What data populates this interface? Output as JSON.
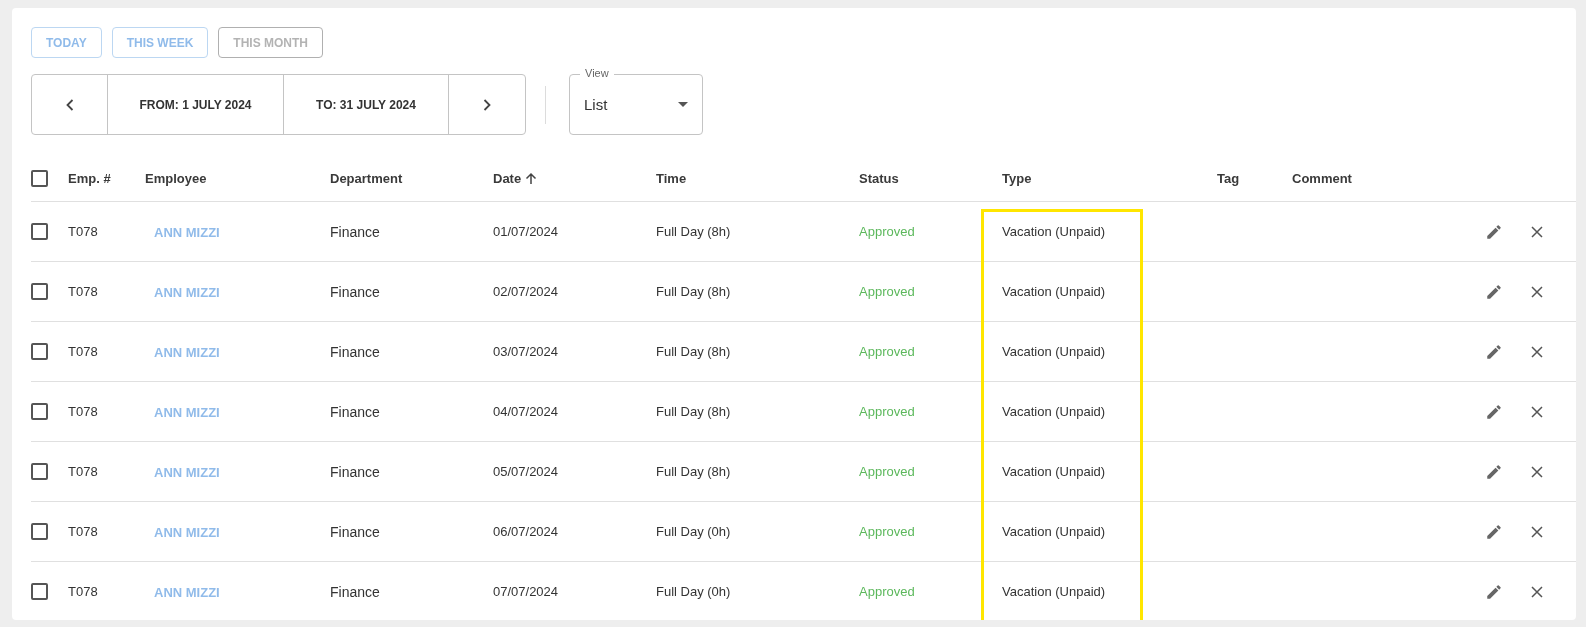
{
  "quick_ranges": [
    {
      "label": "TODAY",
      "disabled": false
    },
    {
      "label": "THIS WEEK",
      "disabled": false
    },
    {
      "label": "THIS MONTH",
      "disabled": true
    }
  ],
  "date_range": {
    "from": "FROM: 1 JULY 2024",
    "to": "TO: 31 JULY 2024"
  },
  "view_select": {
    "label": "View",
    "value": "List"
  },
  "table": {
    "select_all_checked": false,
    "columns": [
      {
        "label": "Emp. #",
        "sorted": false,
        "highlighted": false
      },
      {
        "label": "Employee",
        "sorted": false,
        "highlighted": false
      },
      {
        "label": "Department",
        "sorted": false,
        "highlighted": false
      },
      {
        "label": "Date",
        "sorted": true,
        "highlighted": false
      },
      {
        "label": "Time",
        "sorted": false,
        "highlighted": false
      },
      {
        "label": "Status",
        "sorted": false,
        "highlighted": false
      },
      {
        "label": "Type",
        "sorted": false,
        "highlighted": true
      },
      {
        "label": "Tag",
        "sorted": false,
        "highlighted": false
      },
      {
        "label": "Comment",
        "sorted": false,
        "highlighted": false
      }
    ],
    "rows": [
      {
        "checked": false,
        "emp": "T078",
        "employee": "ANN MIZZI",
        "department": "Finance",
        "date": "01/07/2024",
        "time": "Full Day (8h)",
        "status": "Approved",
        "type": "Vacation (Unpaid)"
      },
      {
        "checked": false,
        "emp": "T078",
        "employee": "ANN MIZZI",
        "department": "Finance",
        "date": "02/07/2024",
        "time": "Full Day (8h)",
        "status": "Approved",
        "type": "Vacation (Unpaid)"
      },
      {
        "checked": false,
        "emp": "T078",
        "employee": "ANN MIZZI",
        "department": "Finance",
        "date": "03/07/2024",
        "time": "Full Day (8h)",
        "status": "Approved",
        "type": "Vacation (Unpaid)"
      },
      {
        "checked": false,
        "emp": "T078",
        "employee": "ANN MIZZI",
        "department": "Finance",
        "date": "04/07/2024",
        "time": "Full Day (8h)",
        "status": "Approved",
        "type": "Vacation (Unpaid)"
      },
      {
        "checked": false,
        "emp": "T078",
        "employee": "ANN MIZZI",
        "department": "Finance",
        "date": "05/07/2024",
        "time": "Full Day (8h)",
        "status": "Approved",
        "type": "Vacation (Unpaid)"
      },
      {
        "checked": false,
        "emp": "T078",
        "employee": "ANN MIZZI",
        "department": "Finance",
        "date": "06/07/2024",
        "time": "Full Day (0h)",
        "status": "Approved",
        "type": "Vacation (Unpaid)"
      },
      {
        "checked": false,
        "emp": "T078",
        "employee": "ANN MIZZI",
        "department": "Finance",
        "date": "07/07/2024",
        "time": "Full Day (0h)",
        "status": "Approved",
        "type": "Vacation (Unpaid)"
      }
    ]
  }
}
